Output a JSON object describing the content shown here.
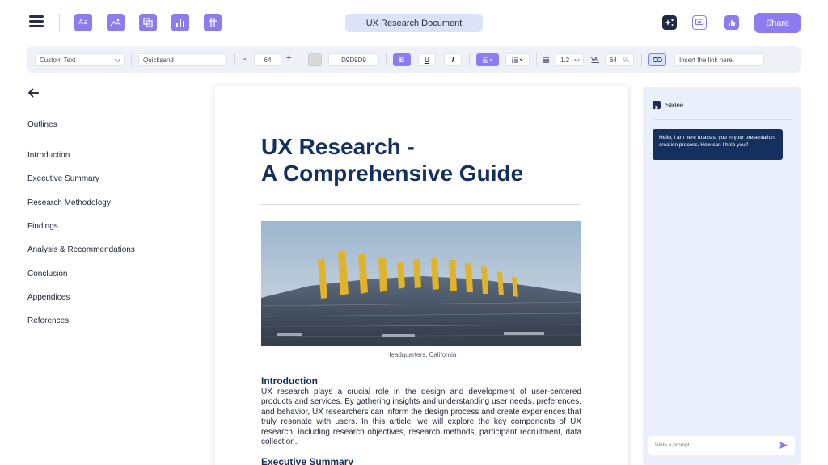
{
  "topbar": {
    "document_title": "UX Research Document",
    "share_label": "Share",
    "tools": [
      "text-icon",
      "image-icon",
      "shapes-icon",
      "chart-icon",
      "layout-icon"
    ],
    "right_tools": [
      "sparkle-icon",
      "comment-icon",
      "analytics-icon"
    ]
  },
  "toolbar": {
    "text_style": "Custom Text",
    "font_family": "Quicksand",
    "minus": "-",
    "font_size": "64",
    "plus": "+",
    "color_hex": "D9D9D9",
    "bold": "B",
    "underline": "U",
    "italic": "I",
    "line_spacing": "1.2",
    "scale": "64",
    "percent": "%",
    "link_placeholder": "Insert the link here."
  },
  "sidebar": {
    "outlines_title": "Outlines",
    "items": [
      {
        "label": "Introduction"
      },
      {
        "label": "Executive Summary"
      },
      {
        "label": "Research Methodology"
      },
      {
        "label": "Findings"
      },
      {
        "label": "Analysis & Recommendations"
      },
      {
        "label": "Conclusion"
      },
      {
        "label": "Appendices"
      },
      {
        "label": "References"
      }
    ]
  },
  "document": {
    "title_line1": "UX Research -",
    "title_line2": "A Comprehensive Guide",
    "image_caption": "Headquarters, California",
    "intro_heading": "Introduction",
    "intro_text": "UX research plays a crucial role in the design and development of user-centered products and services. By gathering insights and understanding user needs, preferences, and behavior, UX researchers can inform the design process and create experiences that truly resonate with users. In this article, we will explore the key components of UX research, including research objectives, research methods, participant recruitment, data collection.",
    "exec_heading": "Executive Summary"
  },
  "chat": {
    "assistant_name": "Slidee",
    "message": "Hello, I am here to assist you in your presentation creation process. How can I help you?",
    "prompt_placeholder": "Write a prompt."
  },
  "colors": {
    "accent": "#8c7cf0",
    "navy": "#14305e",
    "title_pill": "#d9e4f8",
    "chat_bg": "#eaf0fb"
  }
}
